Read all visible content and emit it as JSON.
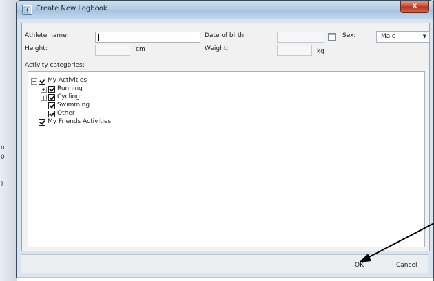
{
  "window": {
    "title": "Create New Logbook",
    "close_glyph": "x"
  },
  "background": {
    "edge_marks": [
      "n",
      "0",
      ")"
    ]
  },
  "form": {
    "athlete_name_label": "Athlete name:",
    "athlete_name_value": "",
    "date_of_birth_label": "Date of birth:",
    "date_of_birth_value": "",
    "sex_label": "Sex:",
    "sex_value": "Male",
    "height_label": "Height:",
    "height_value": "",
    "height_unit": "cm",
    "weight_label": "Weight:",
    "weight_value": "",
    "weight_unit": "kg",
    "activity_categories_label": "Activity categories:"
  },
  "tree": {
    "items": [
      {
        "label": "My Activities",
        "checked": true,
        "expander": "−"
      },
      {
        "label": "Running",
        "checked": true,
        "expander": "+"
      },
      {
        "label": "Cycling",
        "checked": true,
        "expander": "+"
      },
      {
        "label": "Swimming",
        "checked": true,
        "expander": ""
      },
      {
        "label": "Other",
        "checked": true,
        "expander": ""
      },
      {
        "label": "My Friends Activities",
        "checked": true,
        "expander": ""
      }
    ]
  },
  "buttons": {
    "ok": "OK",
    "cancel": "Cancel"
  },
  "icons": {
    "window_icon": "app-window-icon",
    "calendar": "calendar-icon",
    "dropdown": "chevron-down-icon"
  },
  "colors": {
    "dialog_frame": "#d9e4ee",
    "title_gradient": "#b5cde4",
    "close_button": "#c8472d",
    "client_background": "#f1f1f1"
  }
}
